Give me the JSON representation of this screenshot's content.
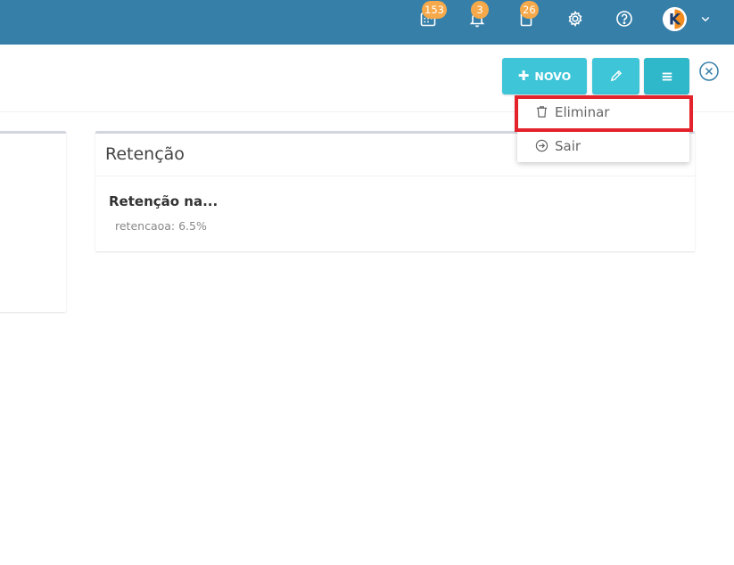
{
  "header": {
    "calendar_badge": "153",
    "notifications_badge": "3",
    "clipboard_badge": "26",
    "avatar_letter": "K"
  },
  "toolbar": {
    "novo_label": "NOVO",
    "novo_icon": "plus-icon",
    "edit_icon": "pencil-icon",
    "menu_icon": "menu-lines-icon",
    "close_icon": "close-circle-icon"
  },
  "dropdown": {
    "items": [
      {
        "label": "Eliminar",
        "icon": "trash-icon"
      },
      {
        "label": "Sair",
        "icon": "exit-arrow-icon"
      }
    ]
  },
  "card": {
    "title": "Retenção",
    "item_title": "Retenção na...",
    "item_sub": "retencaoa: 6.5%"
  },
  "colors": {
    "topbar": "#367fa9",
    "button": "#3ec5d8",
    "badge": "#f6a94a",
    "highlight": "#e3222b"
  }
}
